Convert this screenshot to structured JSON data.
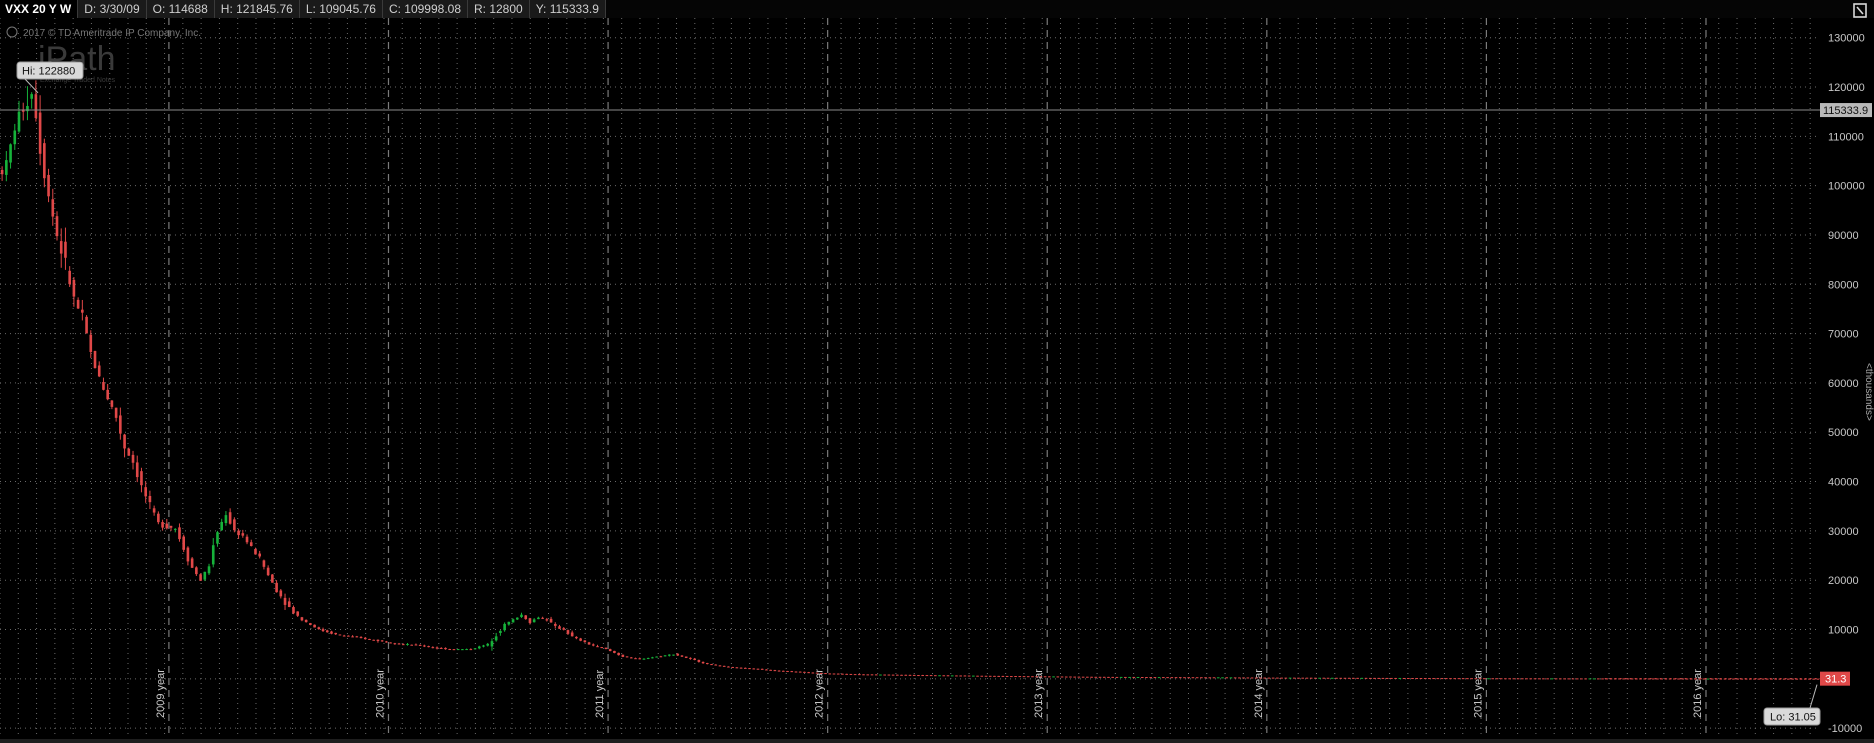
{
  "header": {
    "symbol": "VXX 20 Y W",
    "date": "D: 3/30/09",
    "open": "O: 114688",
    "high": "H: 121845.76",
    "low": "L: 109045.76",
    "close": "C: 109998.08",
    "range": "R: 12800",
    "y": "Y: 115333.9"
  },
  "watermark": {
    "copyright": "2017 © TD Ameritrade IP Company, Inc.",
    "logo": "iPath",
    "logo_sub": "Exchange Traded Notes"
  },
  "annotations": {
    "hi": "Hi: 122880",
    "lo": "Lo: 31.05",
    "last_price": "31.3",
    "cursor_price": "115333.9",
    "axis_unit": "<thousands>"
  },
  "colors": {
    "up": "#16b23a",
    "down": "#e04848",
    "grid": "#6a6a6a",
    "background": "#000000",
    "axis_text": "#c8c8c8",
    "cursor_line": "#8a8a8a",
    "last_price_bg": "#e04848"
  },
  "chart_data": {
    "type": "candlestick",
    "interval": "weekly",
    "ylim": [
      -12000,
      134000
    ],
    "y_ticks": [
      -10000,
      10000,
      20000,
      30000,
      40000,
      50000,
      60000,
      70000,
      80000,
      90000,
      100000,
      110000,
      120000,
      130000
    ],
    "y_tick_labels": [
      "-10000",
      "10000",
      "20000",
      "30000",
      "40000",
      "50000",
      "60000",
      "70000",
      "80000",
      "90000",
      "100000",
      "110000",
      "120000",
      "130000"
    ],
    "year_labels": [
      "2009 year",
      "2010 year",
      "2011 year",
      "2012 year",
      "2013 year",
      "2014 year",
      "2015 year",
      "2016 year"
    ],
    "xlim_weeks": [
      0,
      431
    ],
    "year_marker_weeks": [
      40,
      92,
      144,
      196,
      248,
      300,
      352,
      404
    ],
    "monthly_grid_step_weeks": 4.33,
    "hi_value": 122880,
    "lo_value": 31.05,
    "last_value": 31.3,
    "cursor_value": 115333.9,
    "price_path": [
      [
        0,
        103000
      ],
      [
        2,
        104000
      ],
      [
        4,
        112000
      ],
      [
        6,
        116000
      ],
      [
        8,
        119000
      ],
      [
        9,
        115000
      ],
      [
        10,
        108000
      ],
      [
        12,
        98000
      ],
      [
        14,
        90000
      ],
      [
        16,
        84000
      ],
      [
        18,
        77000
      ],
      [
        20,
        73000
      ],
      [
        22,
        66000
      ],
      [
        24,
        61000
      ],
      [
        26,
        57000
      ],
      [
        28,
        53000
      ],
      [
        30,
        47000
      ],
      [
        32,
        44000
      ],
      [
        34,
        39000
      ],
      [
        36,
        35000
      ],
      [
        38,
        31500
      ],
      [
        40,
        31000
      ],
      [
        42,
        30500
      ],
      [
        44,
        26500
      ],
      [
        46,
        22500
      ],
      [
        48,
        20000
      ],
      [
        50,
        23000
      ],
      [
        52,
        30000
      ],
      [
        54,
        33500
      ],
      [
        56,
        30000
      ],
      [
        58,
        29000
      ],
      [
        60,
        26500
      ],
      [
        62,
        24500
      ],
      [
        64,
        21000
      ],
      [
        66,
        18000
      ],
      [
        68,
        15500
      ],
      [
        70,
        13500
      ],
      [
        72,
        12000
      ],
      [
        74,
        11000
      ],
      [
        76,
        10000
      ],
      [
        80,
        9000
      ],
      [
        84,
        8500
      ],
      [
        88,
        8000
      ],
      [
        92,
        7500
      ],
      [
        96,
        7000
      ],
      [
        100,
        6800
      ],
      [
        104,
        6200
      ],
      [
        108,
        6000
      ],
      [
        112,
        6000
      ],
      [
        114,
        6500
      ],
      [
        116,
        7000
      ],
      [
        118,
        9000
      ],
      [
        120,
        11000
      ],
      [
        122,
        12000
      ],
      [
        124,
        13000
      ],
      [
        126,
        11500
      ],
      [
        128,
        12500
      ],
      [
        130,
        12000
      ],
      [
        132,
        10500
      ],
      [
        134,
        10000
      ],
      [
        136,
        8500
      ],
      [
        140,
        7000
      ],
      [
        144,
        6000
      ],
      [
        148,
        4500
      ],
      [
        152,
        4000
      ],
      [
        156,
        4500
      ],
      [
        160,
        5000
      ],
      [
        164,
        4000
      ],
      [
        168,
        3000
      ],
      [
        172,
        2500
      ],
      [
        176,
        2200
      ],
      [
        180,
        2000
      ],
      [
        184,
        1700
      ],
      [
        188,
        1500
      ],
      [
        192,
        1300
      ],
      [
        196,
        1100
      ],
      [
        205,
        900
      ],
      [
        215,
        800
      ],
      [
        225,
        700
      ],
      [
        235,
        600
      ],
      [
        248,
        500
      ],
      [
        260,
        400
      ],
      [
        275,
        350
      ],
      [
        290,
        300
      ],
      [
        300,
        250
      ],
      [
        320,
        200
      ],
      [
        340,
        150
      ],
      [
        352,
        120
      ],
      [
        370,
        90
      ],
      [
        390,
        70
      ],
      [
        404,
        55
      ],
      [
        420,
        40
      ],
      [
        431,
        31.3
      ]
    ]
  }
}
